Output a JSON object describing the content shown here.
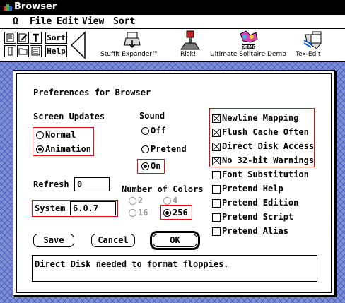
{
  "window": {
    "title": "Browser",
    "title_icon": "browser-app-icon"
  },
  "menubar": {
    "apple": "Ω",
    "items": [
      "File",
      "Edit",
      "View",
      "Sort"
    ]
  },
  "toolbar": {
    "sort_label": "Sort",
    "help_label": "Help",
    "apps": [
      "StuffIt Expander™",
      "Risk!",
      "Ultimate Solitaire Demo",
      "Tex-Edit"
    ],
    "demo_badge": "DEMO"
  },
  "dialog": {
    "title": "Preferences for Browser",
    "screen_updates": {
      "label": "Screen Updates",
      "options": [
        "Normal",
        "Animation"
      ],
      "selected": "Animation"
    },
    "sound": {
      "label": "Sound",
      "options": [
        "Off",
        "Pretend",
        "On"
      ],
      "selected": "On"
    },
    "refresh": {
      "label": "Refresh",
      "value": "0"
    },
    "system": {
      "label": "System",
      "value": "6.0.7"
    },
    "colors": {
      "label": "Number of Colors",
      "options": [
        "2",
        "4",
        "16",
        "256"
      ],
      "selected": "256"
    },
    "checkboxes": [
      {
        "label": "Newline Mapping",
        "checked": true
      },
      {
        "label": "Flush Cache Often",
        "checked": true
      },
      {
        "label": "Direct Disk Access",
        "checked": true
      },
      {
        "label": "No 32-bit Warnings",
        "checked": true
      },
      {
        "label": "Font Substitution",
        "checked": false
      },
      {
        "label": "Pretend Help",
        "checked": false
      },
      {
        "label": "Pretend Edition",
        "checked": false
      },
      {
        "label": "Pretend Script",
        "checked": false
      },
      {
        "label": "Pretend Alias",
        "checked": false
      }
    ],
    "buttons": {
      "save": "Save",
      "cancel": "Cancel",
      "ok": "OK"
    },
    "message": "Direct Disk needed to format floppies."
  },
  "colors": {
    "highlight_box": "#e01010",
    "desktop": "#7f8fd6",
    "desktop_pattern": "#283caa"
  }
}
